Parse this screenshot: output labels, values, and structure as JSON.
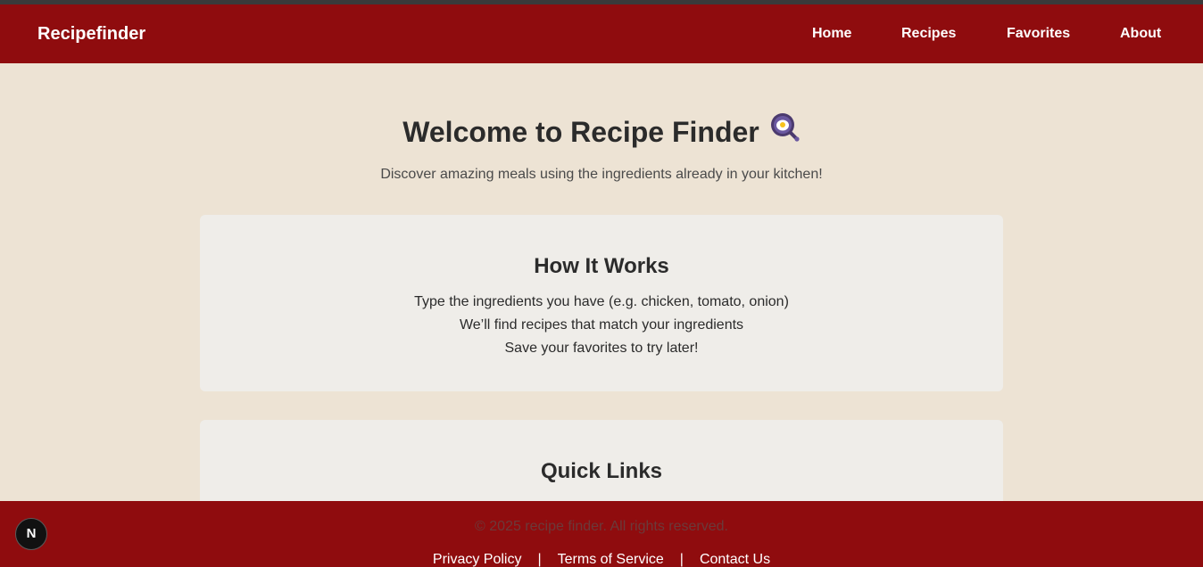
{
  "header": {
    "brand": "Recipefinder",
    "nav": {
      "home": "Home",
      "recipes": "Recipes",
      "favorites": "Favorites",
      "about": "About"
    }
  },
  "hero": {
    "title": "Welcome to Recipe Finder",
    "icon": "frying-pan-egg-icon",
    "subtitle": "Discover amazing meals using the ingredients already in your kitchen!"
  },
  "how_it_works": {
    "title": "How It Works",
    "steps": [
      "Type the ingredients you have (e.g. chicken, tomato, onion)",
      "We’ll find recipes that match your ingredients",
      "Save your favorites to try later!"
    ]
  },
  "quick_links": {
    "title": "Quick Links"
  },
  "footer": {
    "copyright": "© 2025 recipe finder. All rights reserved.",
    "links": {
      "privacy": "Privacy Policy",
      "terms": "Terms of Service",
      "contact": "Contact Us"
    },
    "separator": "|"
  },
  "dev_badge": {
    "label": "N"
  },
  "colors": {
    "primary": "#8f0c0e",
    "background": "#ede3d4",
    "card": "#efede9"
  }
}
